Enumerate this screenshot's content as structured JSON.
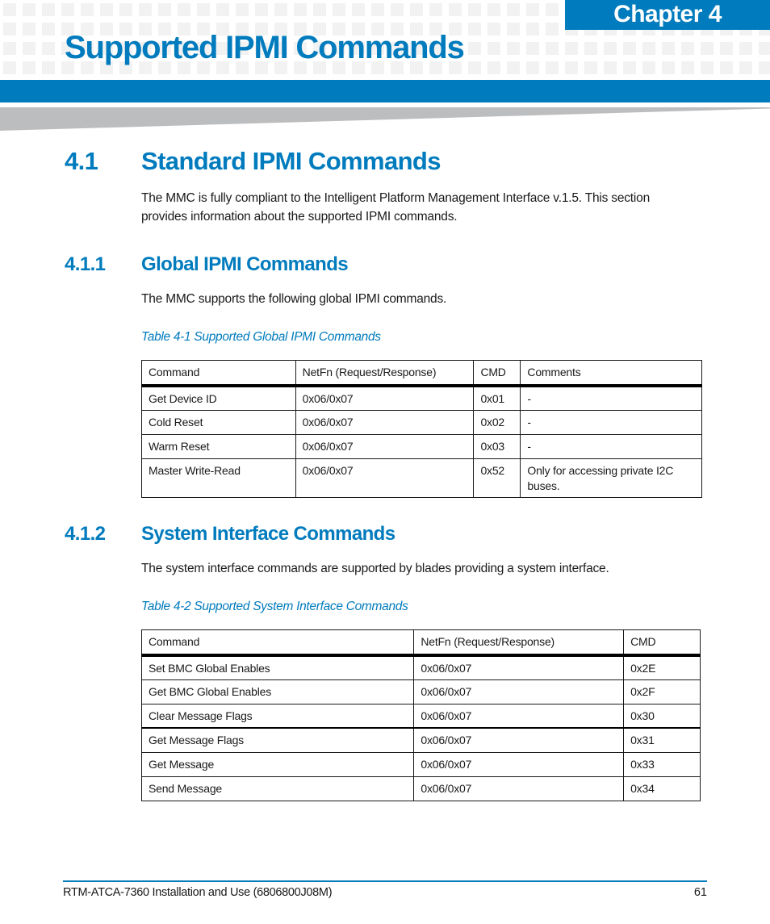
{
  "header": {
    "chapter_label": "Chapter 4",
    "chapter_title": "Supported IPMI Commands",
    "accent_color": "#007bbd"
  },
  "section_4_1": {
    "number": "4.1",
    "title": "Standard IPMI Commands",
    "body": "The MMC is fully compliant to the Intelligent Platform Management Interface v.1.5. This section provides information about the supported IPMI commands."
  },
  "section_4_1_1": {
    "number": "4.1.1",
    "title": "Global IPMI Commands",
    "body": "The MMC supports the following global IPMI commands.",
    "table_caption": "Table 4-1 Supported Global IPMI Commands",
    "table": {
      "headers": [
        "Command",
        "NetFn (Request/Response)",
        "CMD",
        "Comments"
      ],
      "rows": [
        [
          "Get Device ID",
          "0x06/0x07",
          "0x01",
          "-"
        ],
        [
          "Cold Reset",
          "0x06/0x07",
          "0x02",
          "-"
        ],
        [
          "Warm Reset",
          "0x06/0x07",
          "0x03",
          "-"
        ],
        [
          "Master Write-Read",
          "0x06/0x07",
          "0x52",
          "Only for accessing private I2C buses."
        ]
      ]
    }
  },
  "section_4_1_2": {
    "number": "4.1.2",
    "title": "System Interface Commands",
    "body": "The system interface commands are supported by blades providing a system interface.",
    "table_caption": "Table 4-2 Supported System Interface Commands",
    "table": {
      "headers": [
        "Command",
        "NetFn (Request/Response)",
        "CMD"
      ],
      "rows": [
        [
          "Set BMC Global Enables",
          "0x06/0x07",
          "0x2E"
        ],
        [
          "Get BMC Global Enables",
          "0x06/0x07",
          "0x2F"
        ],
        [
          "Clear Message Flags",
          "0x06/0x07",
          "0x30"
        ],
        [
          "Get Message Flags",
          "0x06/0x07",
          "0x31"
        ],
        [
          "Get Message",
          "0x06/0x07",
          "0x33"
        ],
        [
          "Send Message",
          "0x06/0x07",
          "0x34"
        ]
      ]
    }
  },
  "footer": {
    "document_title": "RTM-ATCA-7360 Installation and Use (6806800J08M)",
    "page_number": "61"
  }
}
